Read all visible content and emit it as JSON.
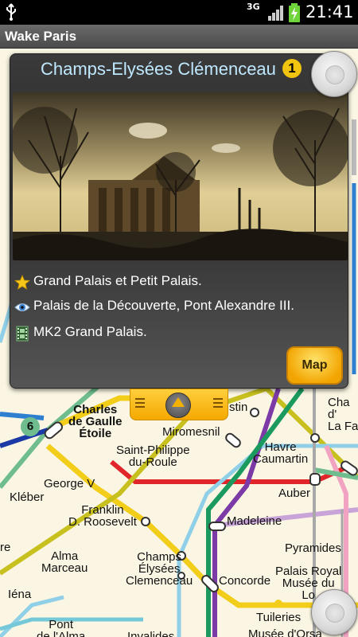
{
  "status_bar": {
    "network": "3G",
    "time": "21:41"
  },
  "app": {
    "title": "Wake Paris"
  },
  "popup": {
    "station_name": "Champs-Elysées Clémenceau",
    "line_number": "1",
    "items": [
      {
        "icon": "star-icon",
        "text": "Grand Palais et Petit Palais."
      },
      {
        "icon": "eye-icon",
        "text": "Palais de la Découverte, Pont Alexandre III."
      },
      {
        "icon": "film-icon",
        "text": "MK2 Grand Palais."
      }
    ],
    "map_button_label": "Map"
  },
  "map": {
    "line_badge": "6",
    "stations": [
      {
        "id": "charles-de-gaulle",
        "text": "Charles de Gaulle Étoile",
        "lines": [
          "Charles",
          "de Gaulle",
          "Étoile"
        ]
      },
      {
        "id": "miromesnil",
        "text": "Miromesnil"
      },
      {
        "id": "saint-philippe",
        "lines": [
          "Saint-Philippe",
          "du-Roule"
        ]
      },
      {
        "id": "george-v",
        "text": "George V"
      },
      {
        "id": "kleber",
        "text": "Kléber"
      },
      {
        "id": "franklin",
        "lines": [
          "Franklin",
          "D. Roosevelt"
        ]
      },
      {
        "id": "alma-marceau",
        "lines": [
          "Alma",
          "Marceau"
        ]
      },
      {
        "id": "champs-elysees",
        "lines": [
          "Champs",
          "Élysées",
          "Clemenceau"
        ]
      },
      {
        "id": "concorde",
        "text": "Concorde"
      },
      {
        "id": "madeleine",
        "text": "Madeleine"
      },
      {
        "id": "havre",
        "lines": [
          "Havre",
          "Caumartin"
        ]
      },
      {
        "id": "auber",
        "text": "Auber"
      },
      {
        "id": "pyramides",
        "text": "Pyramides"
      },
      {
        "id": "palais-royal",
        "lines": [
          "Palais Royal",
          "Musée du",
          "Lo"
        ]
      },
      {
        "id": "iena",
        "text": "Iéna"
      },
      {
        "id": "pont-alma",
        "lines": [
          "Pont",
          "de l'Alma"
        ]
      },
      {
        "id": "invalides",
        "text": "Invalides"
      },
      {
        "id": "tuileries",
        "text": "Tuileries"
      },
      {
        "id": "musee-orsay",
        "text": "Musée d'Orsa"
      },
      {
        "id": "chaussee",
        "lines": [
          "Cha",
          "d'",
          "La Fa"
        ]
      },
      {
        "id": "stin",
        "text": "stin"
      },
      {
        "id": "ire",
        "text": "re"
      }
    ]
  },
  "colors": {
    "accent": "#f5a900",
    "title_text": "#bfe8ff",
    "map_background": "#fbf6e3"
  }
}
